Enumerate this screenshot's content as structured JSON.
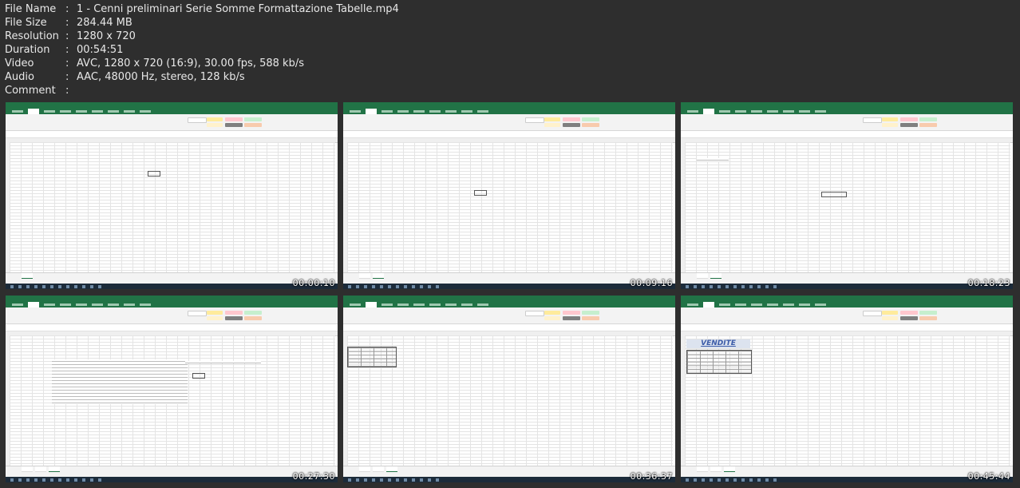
{
  "file_info": [
    {
      "label": "File Name",
      "value": "1 - Cenni preliminari Serie Somme Formattazione Tabelle.mp4"
    },
    {
      "label": "File Size",
      "value": "284.44 MB"
    },
    {
      "label": "Resolution",
      "value": "1280 x 720"
    },
    {
      "label": "Duration",
      "value": "00:54:51"
    },
    {
      "label": "Video",
      "value": "AVC, 1280 x 720 (16:9), 30.00 fps, 588 kb/s"
    },
    {
      "label": "Audio",
      "value": "AAC, 48000 Hz, stereo, 128 kb/s"
    },
    {
      "label": "Comment",
      "value": ""
    }
  ],
  "separator": ":",
  "thumbnails": [
    {
      "timestamp": "00:00:10"
    },
    {
      "timestamp": "00:09:16"
    },
    {
      "timestamp": "00:18:23"
    },
    {
      "timestamp": "00:27:30"
    },
    {
      "timestamp": "00:36:37"
    },
    {
      "timestamp": "00:45:44",
      "sheet_title": "VENDITE"
    }
  ],
  "colors": {
    "excel_green": "#217346",
    "background": "#2e2e2e"
  }
}
